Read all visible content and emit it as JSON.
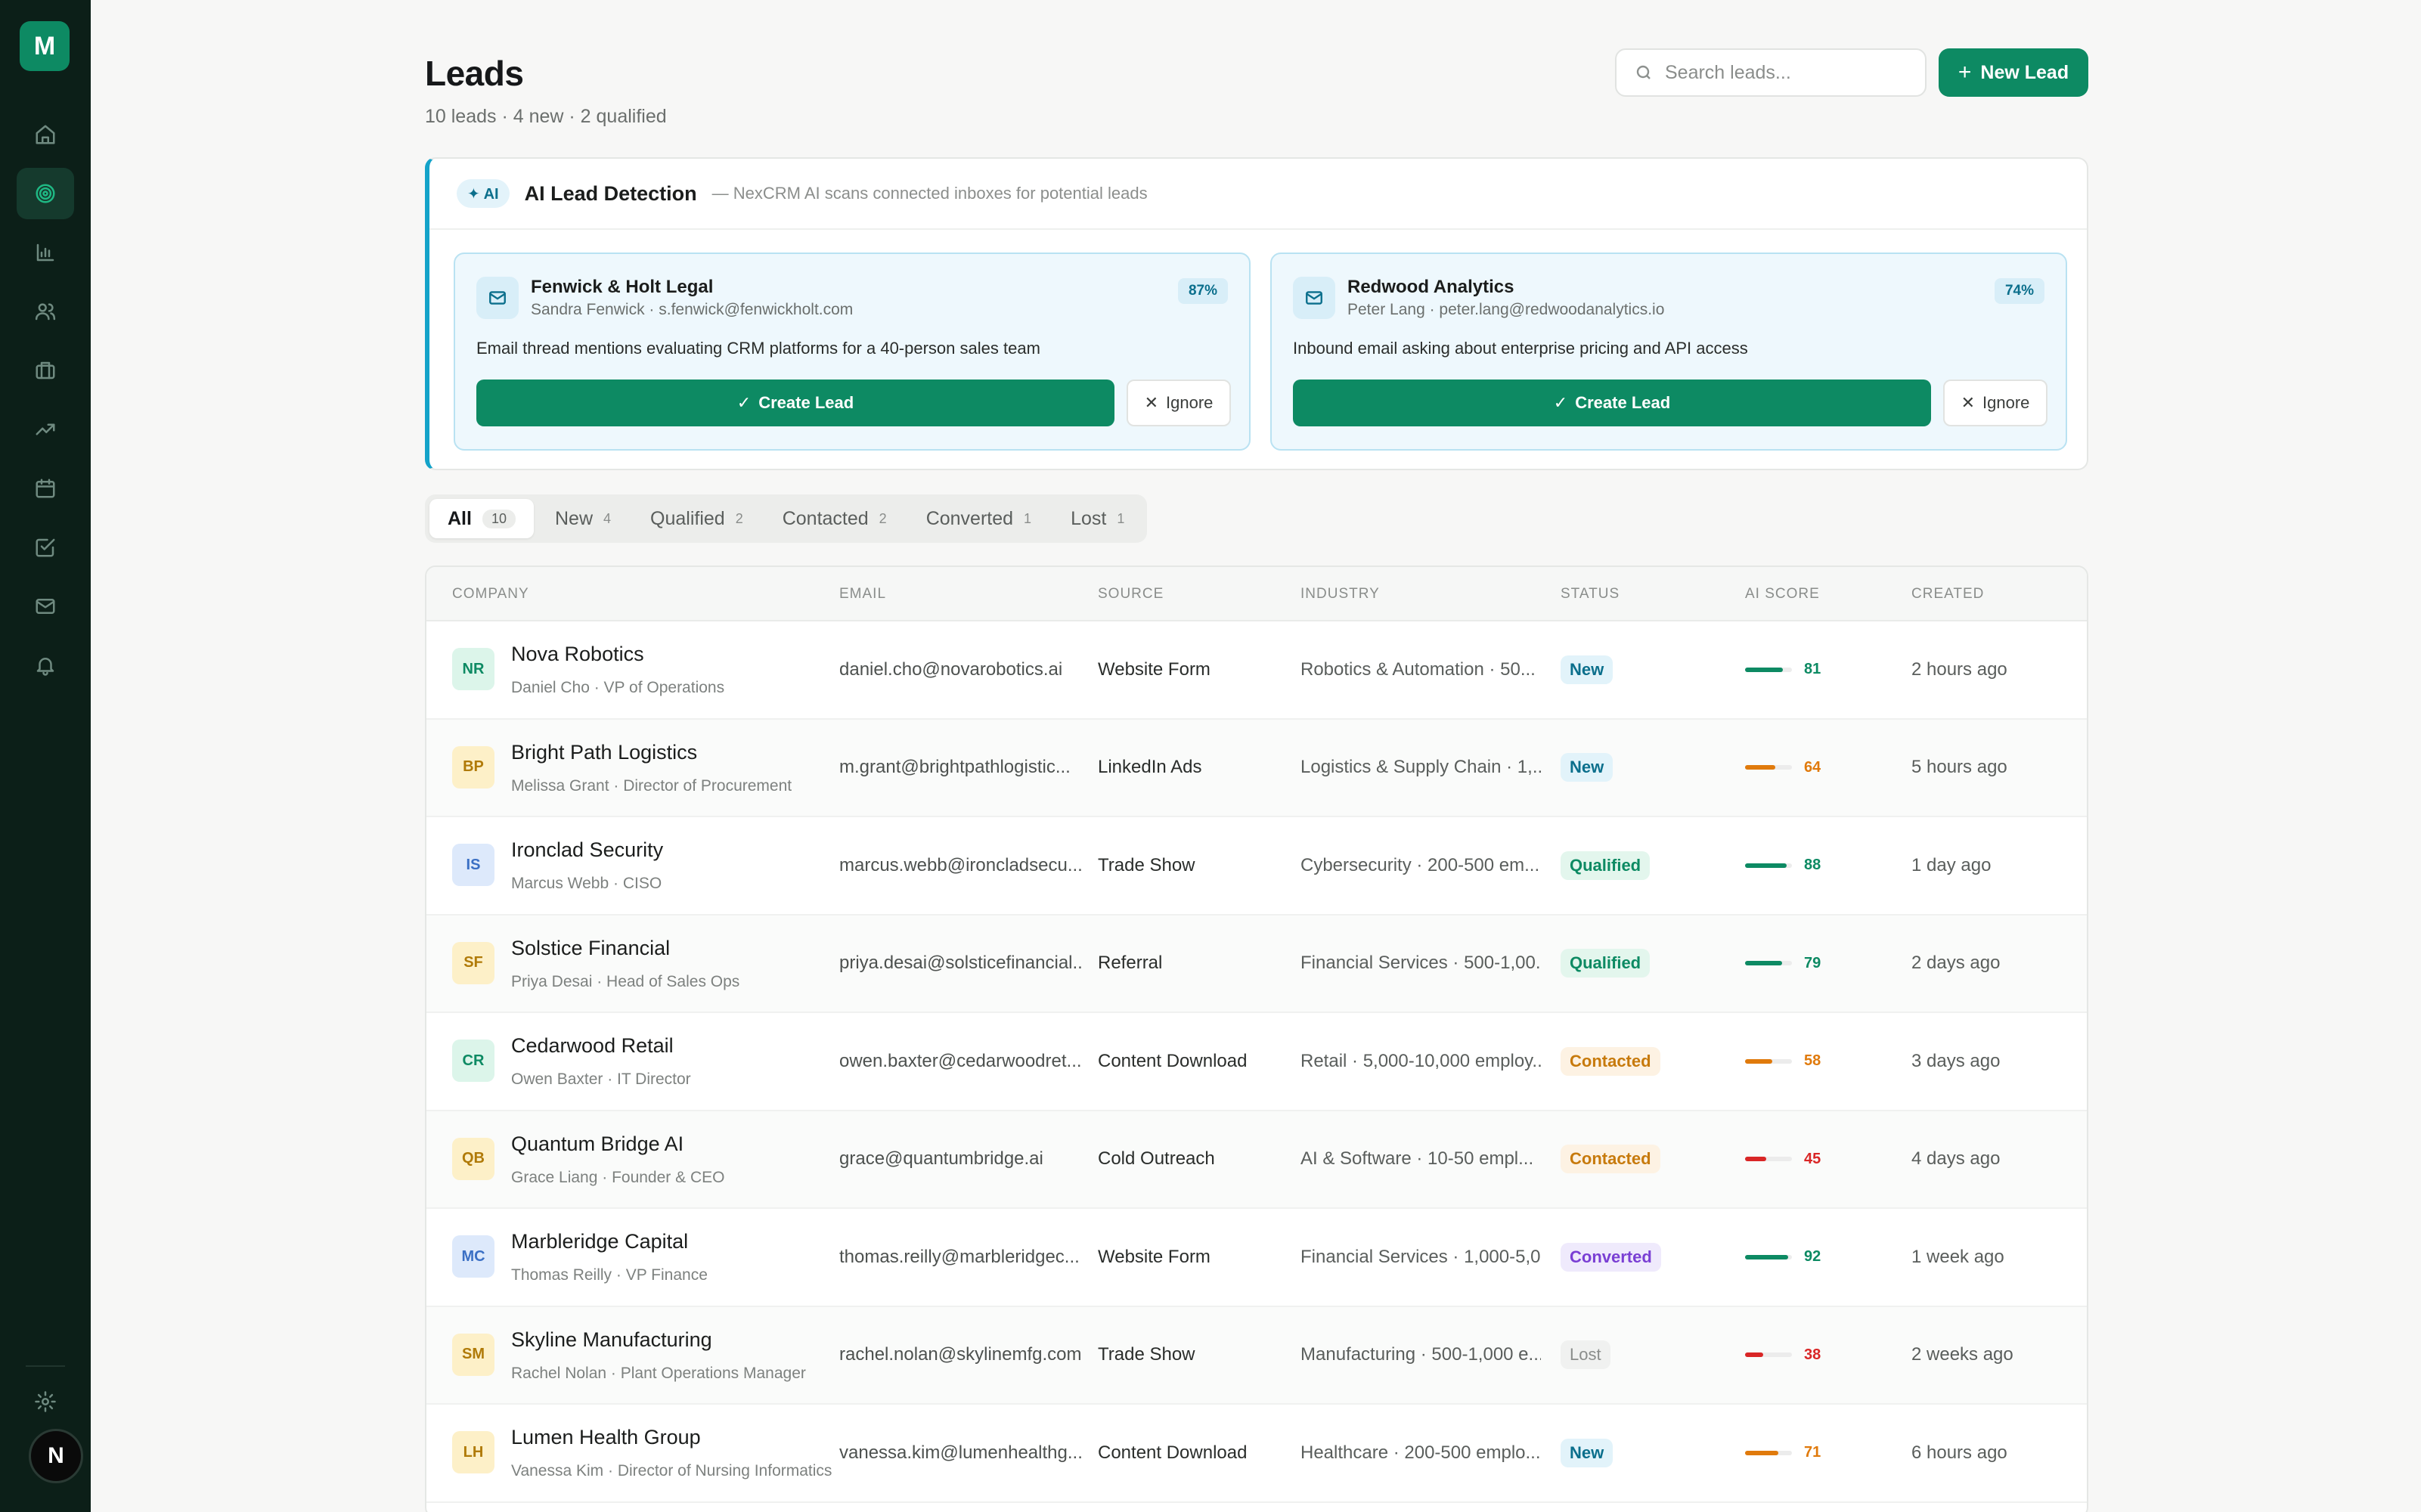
{
  "app": {
    "logo_letter": "M",
    "user_initial": "N"
  },
  "nav": [
    "home-icon",
    "target-icon",
    "bar-chart-icon",
    "users-icon",
    "briefcase-icon",
    "trending-icon",
    "calendar-icon",
    "check-square-icon",
    "mail-icon",
    "bell-icon",
    "settings-icon"
  ],
  "header": {
    "title": "Leads",
    "subtitle": "10 leads · 4 new · 2 qualified",
    "search_placeholder": "Search leads...",
    "new_lead_label": "New Lead"
  },
  "ai_panel": {
    "badge": "✦ AI",
    "title": "AI Lead Detection",
    "description": "— NexCRM AI scans connected inboxes for potential leads",
    "suggestions": [
      {
        "name": "Fenwick & Holt Legal",
        "contact": "Sandra Fenwick · s.fenwick@fenwickholt.com",
        "confidence": "87%",
        "reason": "Email thread mentions evaluating CRM platforms for a 40-person sales team",
        "create_label": "Create Lead",
        "ignore_label": "Ignore"
      },
      {
        "name": "Redwood Analytics",
        "contact": "Peter Lang · peter.lang@redwoodanalytics.io",
        "confidence": "74%",
        "reason": "Inbound email asking about enterprise pricing and API access",
        "create_label": "Create Lead",
        "ignore_label": "Ignore"
      }
    ]
  },
  "tabs": [
    {
      "label": "All",
      "count": "10",
      "active": true
    },
    {
      "label": "New",
      "count": "4"
    },
    {
      "label": "Qualified",
      "count": "2"
    },
    {
      "label": "Contacted",
      "count": "2"
    },
    {
      "label": "Converted",
      "count": "1"
    },
    {
      "label": "Lost",
      "count": "1"
    }
  ],
  "table": {
    "columns": [
      "COMPANY",
      "EMAIL",
      "SOURCE",
      "INDUSTRY",
      "STATUS",
      "AI SCORE",
      "CREATED"
    ],
    "rows": [
      {
        "initials": "NR",
        "avatar_bg": "#dcf5ea",
        "avatar_fg": "#0d8a63",
        "company": "Nova Robotics",
        "person": "Daniel Cho · VP of Operations",
        "email": "daniel.cho@novarobotics.ai",
        "source": "Website Form",
        "industry": "Robotics & Automation · 50...",
        "status": "New",
        "score": 81,
        "score_color": "#0d8a63",
        "created": "2 hours ago"
      },
      {
        "initials": "BP",
        "avatar_bg": "#fdf0c8",
        "avatar_fg": "#b07a08",
        "company": "Bright Path Logistics",
        "person": "Melissa Grant · Director of Procurement",
        "email": "m.grant@brightpathlogistic...",
        "source": "LinkedIn Ads",
        "industry": "Logistics & Supply Chain · 1,...",
        "status": "New",
        "score": 64,
        "score_color": "#e07a0c",
        "created": "5 hours ago"
      },
      {
        "initials": "IS",
        "avatar_bg": "#dde9fb",
        "avatar_fg": "#3a6fc4",
        "company": "Ironclad Security",
        "person": "Marcus Webb · CISO",
        "email": "marcus.webb@ironcladsecu...",
        "source": "Trade Show",
        "industry": "Cybersecurity · 200-500 em...",
        "status": "Qualified",
        "score": 88,
        "score_color": "#0d8a63",
        "created": "1 day ago"
      },
      {
        "initials": "SF",
        "avatar_bg": "#fdf0c8",
        "avatar_fg": "#b07a08",
        "company": "Solstice Financial",
        "person": "Priya Desai · Head of Sales Ops",
        "email": "priya.desai@solsticefinancial...",
        "source": "Referral",
        "industry": "Financial Services · 500-1,00...",
        "status": "Qualified",
        "score": 79,
        "score_color": "#0d8a63",
        "created": "2 days ago"
      },
      {
        "initials": "CR",
        "avatar_bg": "#dcf5ea",
        "avatar_fg": "#0d8a63",
        "company": "Cedarwood Retail",
        "person": "Owen Baxter · IT Director",
        "email": "owen.baxter@cedarwoodret...",
        "source": "Content Download",
        "industry": "Retail · 5,000-10,000 employ...",
        "status": "Contacted",
        "score": 58,
        "score_color": "#e07a0c",
        "created": "3 days ago"
      },
      {
        "initials": "QB",
        "avatar_bg": "#fdf0c8",
        "avatar_fg": "#b07a08",
        "company": "Quantum Bridge AI",
        "person": "Grace Liang · Founder & CEO",
        "email": "grace@quantumbridge.ai",
        "source": "Cold Outreach",
        "industry": "AI & Software · 10-50 empl...",
        "status": "Contacted",
        "score": 45,
        "score_color": "#d92626",
        "created": "4 days ago"
      },
      {
        "initials": "MC",
        "avatar_bg": "#dde9fb",
        "avatar_fg": "#3a6fc4",
        "company": "Marbleridge Capital",
        "person": "Thomas Reilly · VP Finance",
        "email": "thomas.reilly@marbleridgec...",
        "source": "Website Form",
        "industry": "Financial Services · 1,000-5,0...",
        "status": "Converted",
        "score": 92,
        "score_color": "#0d8a63",
        "created": "1 week ago"
      },
      {
        "initials": "SM",
        "avatar_bg": "#fdf0c8",
        "avatar_fg": "#b07a08",
        "company": "Skyline Manufacturing",
        "person": "Rachel Nolan · Plant Operations Manager",
        "email": "rachel.nolan@skylinemfg.com",
        "source": "Trade Show",
        "industry": "Manufacturing · 500-1,000 e...",
        "status": "Lost",
        "score": 38,
        "score_color": "#d92626",
        "created": "2 weeks ago"
      },
      {
        "initials": "LH",
        "avatar_bg": "#fdf0c8",
        "avatar_fg": "#b07a08",
        "company": "Lumen Health Group",
        "person": "Vanessa Kim · Director of Nursing Informatics",
        "email": "vanessa.kim@lumenhealthg...",
        "source": "Content Download",
        "industry": "Healthcare · 200-500 emplo...",
        "status": "New",
        "score": 71,
        "score_color": "#e07a0c",
        "created": "6 hours ago"
      }
    ]
  }
}
